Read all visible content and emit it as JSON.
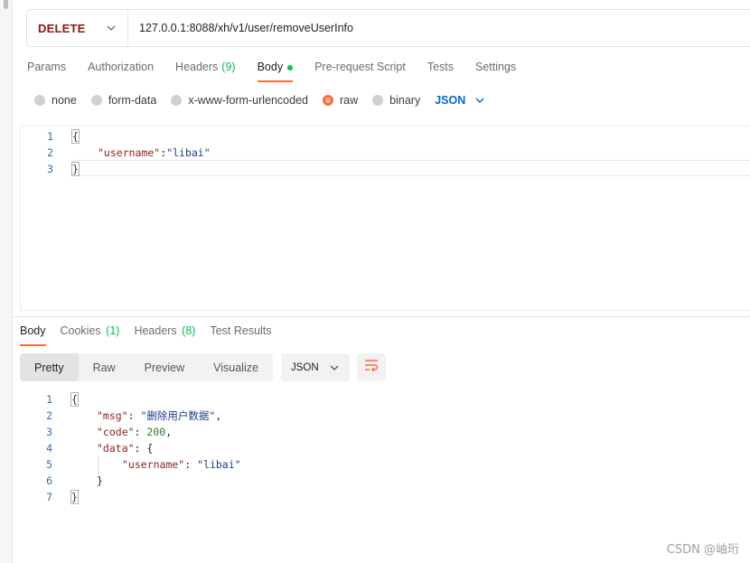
{
  "request": {
    "method": "DELETE",
    "url": "127.0.0.1:8088/xh/v1/user/removeUserInfo"
  },
  "request_tabs": {
    "params": "Params",
    "authorization": "Authorization",
    "headers": "Headers",
    "headers_count": "(9)",
    "body": "Body",
    "prerequest": "Pre-request Script",
    "tests": "Tests",
    "settings": "Settings"
  },
  "body_types": {
    "none": "none",
    "form_data": "form-data",
    "urlencoded": "x-www-form-urlencoded",
    "raw": "raw",
    "binary": "binary",
    "format": "JSON",
    "selected": "raw"
  },
  "request_body": {
    "lines": [
      {
        "n": "1",
        "text": "{"
      },
      {
        "n": "2",
        "key": "\"username\"",
        "sep": ":",
        "value": "\"libai\""
      },
      {
        "n": "3",
        "text": "}"
      }
    ]
  },
  "response_tabs": {
    "body": "Body",
    "cookies": "Cookies",
    "cookies_count": "(1)",
    "headers": "Headers",
    "headers_count": "(8)",
    "test_results": "Test Results"
  },
  "response_view": {
    "pretty": "Pretty",
    "raw": "Raw",
    "preview": "Preview",
    "visualize": "Visualize",
    "format": "JSON"
  },
  "response_body": {
    "l1": "{",
    "l2_key": "\"msg\"",
    "l2_val": "\"删除用户数据\"",
    "l3_key": "\"code\"",
    "l3_val": "200",
    "l4_key": "\"data\"",
    "l5_key": "\"username\"",
    "l5_val": "\"libai\"",
    "l6": "}",
    "l7": "}",
    "line_numbers": [
      "1",
      "2",
      "3",
      "4",
      "5",
      "6",
      "7"
    ]
  },
  "watermark": "CSDN @岫珩",
  "colors": {
    "accent": "#ff6c37",
    "method": "#8e1a10",
    "count_green": "#0cbb52",
    "json_blue": "#0265d2"
  }
}
